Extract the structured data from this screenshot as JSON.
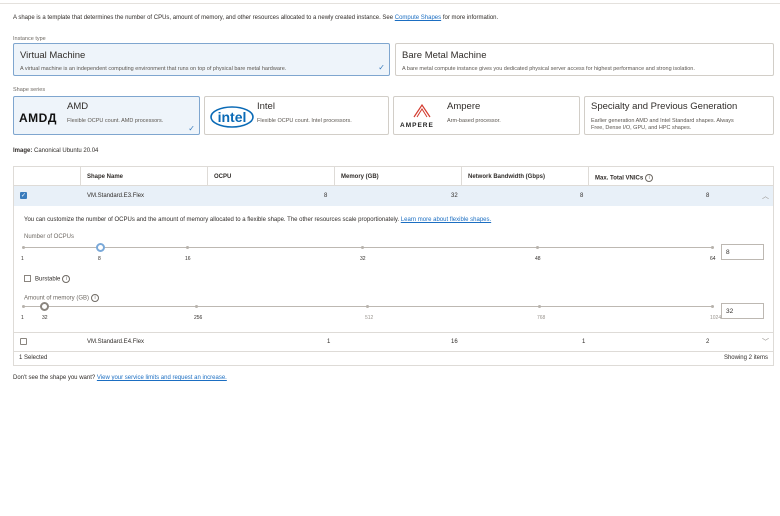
{
  "intro": {
    "text": "A shape is a template that determines the number of CPUs, amount of memory, and other resources allocated to a newly created instance. See",
    "link": "Compute Shapes",
    "suffix": "for more information."
  },
  "instance_type": {
    "label": "Instance type",
    "options": [
      {
        "title": "Virtual Machine",
        "desc": "A virtual machine is an independent computing environment that runs on top of physical bare metal hardware.",
        "selected": true
      },
      {
        "title": "Bare Metal Machine",
        "desc": "A bare metal compute instance gives you dedicated physical server access for highest performance and strong isolation.",
        "selected": false
      }
    ]
  },
  "shape_series": {
    "label": "Shape series",
    "options": [
      {
        "title": "AMD",
        "logo": "AMDД",
        "desc": "Flexible OCPU count. AMD processors.",
        "selected": true
      },
      {
        "title": "Intel",
        "logo": "intel",
        "desc": "Flexible OCPU count. Intel processors.",
        "selected": false
      },
      {
        "title": "Ampere",
        "logo": "AMPERE",
        "desc": "Arm-based processor.",
        "selected": false
      },
      {
        "title": "Specialty and Previous Generation",
        "desc_line1": "Earlier generation AMD and Intel Standard shapes. Always",
        "desc_line2": "Free, Dense I/O, GPU, and HPC shapes.",
        "selected": false
      }
    ]
  },
  "image": {
    "label": "Image:",
    "value": "Canonical Ubuntu 20.04"
  },
  "table": {
    "headers": [
      "Shape Name",
      "OCPU",
      "Memory (GB)",
      "Network Bandwidth (Gbps)",
      "Max. Total VNICs"
    ],
    "rows": [
      {
        "name": "VM.Standard.E3.Flex",
        "ocpu": "8",
        "memory": "32",
        "bandwidth": "8",
        "vnics": "8",
        "selected": true,
        "expanded": true
      },
      {
        "name": "VM.Standard.E4.Flex",
        "ocpu": "1",
        "memory": "16",
        "bandwidth": "1",
        "vnics": "2",
        "selected": false,
        "expanded": false
      }
    ],
    "selected_count": "1 Selected",
    "showing": "Showing 2 items"
  },
  "flex": {
    "note": "You can customize the number of OCPUs and the amount of memory allocated to a flexible shape. The other resources scale proportionately.",
    "note_link": "Learn more about flexible shapes.",
    "ocpu": {
      "label": "Number of OCPUs",
      "value": "8",
      "min": 1,
      "max": 64,
      "current": 8,
      "ticks": [
        {
          "v": 1,
          "label": "1"
        },
        {
          "v": 8,
          "label": "8"
        },
        {
          "v": 16,
          "label": "16"
        },
        {
          "v": 32,
          "label": "32"
        },
        {
          "v": 48,
          "label": "48"
        },
        {
          "v": 64,
          "label": "64"
        }
      ]
    },
    "burstable_label": "Burstable",
    "memory": {
      "label": "Amount of memory (GB)",
      "value": "32",
      "min": 1,
      "max": 1024,
      "current": 32,
      "ticks": [
        {
          "v": 1,
          "label": "1"
        },
        {
          "v": 32,
          "label": "32"
        },
        {
          "v": 256,
          "label": "256"
        },
        {
          "v": 512,
          "label": "512"
        },
        {
          "v": 768,
          "label": "768"
        },
        {
          "v": 1024,
          "label": "1024"
        }
      ]
    }
  },
  "bottom": {
    "text": "Don't see the shape you want?",
    "link": "View your service limits and request an increase."
  },
  "colors": {
    "accent": "#3a7cbd",
    "selected_bg": "#eef4fa"
  }
}
